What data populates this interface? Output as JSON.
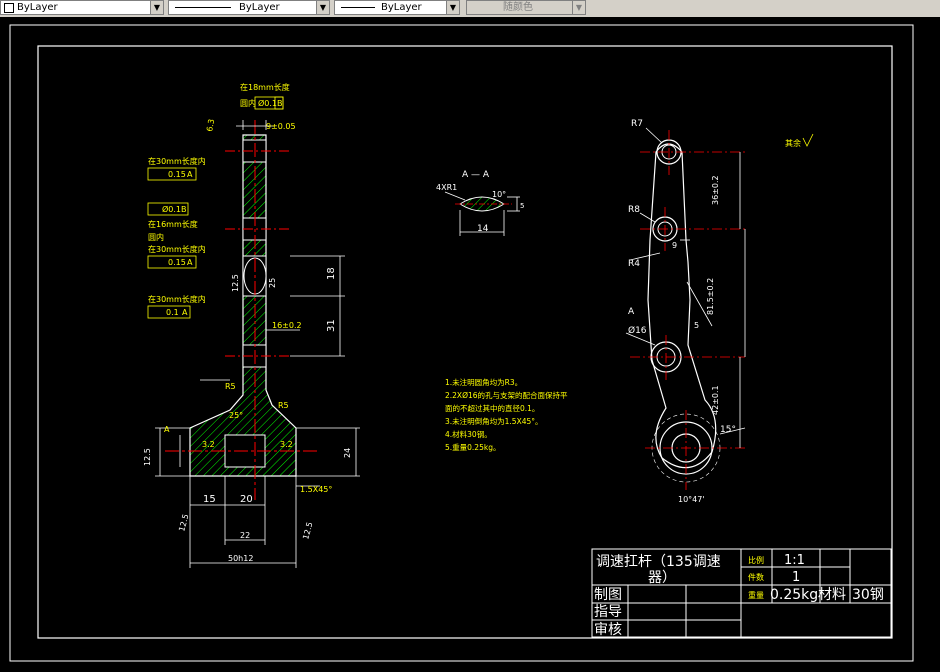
{
  "toolbar": {
    "color_value": "ByLayer",
    "linetype_value": "ByLayer",
    "lineweight_value": "ByLayer",
    "plotstyle_value": "随颜色"
  },
  "colors": {
    "background": "#000000",
    "frame": "#ffffff",
    "hatch": "#00ff00",
    "centerline": "#ff0000",
    "annotation": "#ffff00",
    "toolbar_bg": "#d4d0c8"
  },
  "drawing": {
    "section_label": "A — A",
    "sec_dim_r": "4XR1",
    "sec_dim_angle": "10°",
    "sec_dim_width": "14",
    "sec_dim_small": "5",
    "front": {
      "tol_top": "在18mm长度",
      "tol_top2": "圆内",
      "tol_top_val": "Ø0.1",
      "tol_top_ref": "B",
      "rough_63": "6.3",
      "dim_9": "9±0.05",
      "tol_30_a": "在30mm长度内",
      "tol_30_a_val": "0.15",
      "tol_30_a_ref": "A",
      "tol_b_val": "Ø0.1",
      "tol_b_ref": "B",
      "tol_16": "在16mm长度",
      "tol_16_2": "圆内",
      "tol_30_b": "在30mm长度内",
      "tol_30_b_val": "0.15",
      "tol_30_b_ref": "A",
      "tol_30_c": "在30mm长度内",
      "tol_30_c_val": "0.1",
      "tol_30_c_ref": "A",
      "dim_125": "12.5",
      "dim_25": "25",
      "dim_18": "18",
      "dim_16": "16±0.2",
      "dim_31": "31",
      "dim_r5a": "R5",
      "dim_r5b": "R5",
      "dim_25deg": "25°",
      "dim_32": "3.2",
      "dim_24": "24",
      "dim_125b": "12.5",
      "dim_15": "15",
      "dim_20": "20",
      "dim_22": "22",
      "dim_50": "50h12",
      "dim_chamfer": "1.5X45°",
      "dim_125c": "12.5",
      "dim_125d": "12.5",
      "datum_a": "A"
    },
    "side": {
      "r7": "R7",
      "r8": "R8",
      "r4": "R4",
      "phi16": "Ø16",
      "dim_9": "9",
      "dim_5": "5",
      "dim_36": "36±0.2",
      "dim_815": "81.5±0.2",
      "dim_42": "42±0.1",
      "dim_15deg": "15°",
      "dim_1047": "10°47'",
      "label_a": "A",
      "rough_note": "其余"
    },
    "notes": [
      "1.未注明圆角均为R3。",
      "2.2XØ16的孔与支架的配合面保持平",
      "   面的不超过其中的直径0.1。",
      "3.未注明倒角均为1.5X45°。",
      "4.材料30钢。",
      "5.重量0.25kg。"
    ]
  },
  "title_block": {
    "title_line1": "调速扛杆（135调速",
    "title_line2": "器）",
    "scale_label": "比例",
    "scale_value": "1:1",
    "qty_label": "件数",
    "qty_value": "1",
    "weight_label": "重量",
    "weight_value": "0.25kg",
    "material_label": "材料",
    "material_value": "30钢",
    "drawn_label": "制图",
    "guided_label": "指导",
    "checked_label": "审核"
  }
}
